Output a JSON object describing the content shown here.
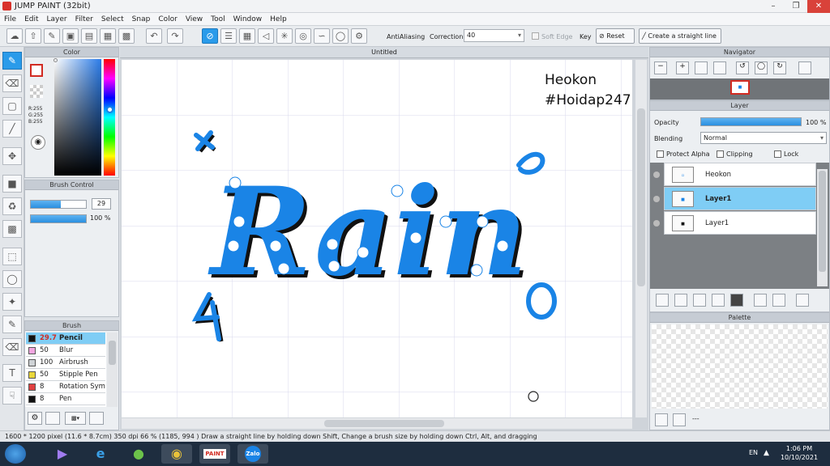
{
  "window": {
    "title": "JUMP PAINT (32bit)"
  },
  "menu": [
    "File",
    "Edit",
    "Layer",
    "Filter",
    "Select",
    "Snap",
    "Color",
    "View",
    "Tool",
    "Window",
    "Help"
  ],
  "toolbar": {
    "antialiasing_label": "AntiAliasing",
    "correction_label": "Correction",
    "correction_value": "40",
    "soft_edge_label": "Soft Edge",
    "key_label": "Key",
    "reset_label": "Reset",
    "straight_line_label": "Create a straight line"
  },
  "color_panel": {
    "title": "Color",
    "r": "R:255",
    "g": "G:255",
    "b": "B:255",
    "primary": "#ffffff",
    "secondary": "#d12b22"
  },
  "brush_control": {
    "title": "Brush Control",
    "size": "29",
    "opacity": "100 %",
    "opacity_fill": 1.0,
    "size_fill": 0.55
  },
  "brush_panel": {
    "title": "Brush",
    "items": [
      {
        "size": "29.7",
        "name": "Pencil",
        "color": "#111111",
        "selected": true
      },
      {
        "size": "50",
        "name": "Blur",
        "color": "#f3a6e0",
        "selected": false
      },
      {
        "size": "100",
        "name": "Airbrush",
        "color": "#cfd3d6",
        "selected": false
      },
      {
        "size": "50",
        "name": "Stipple Pen",
        "color": "#e9d63a",
        "selected": false
      },
      {
        "size": "8",
        "name": "Rotation Symmetry",
        "color": "#e04040",
        "selected": false
      },
      {
        "size": "8",
        "name": "Pen",
        "color": "#111111",
        "selected": false
      }
    ]
  },
  "document": {
    "tab": "Untitled",
    "text_line1": "Heokon",
    "text_line2": "#Hoidap247",
    "art_word": "Rain",
    "art_color": "#1a84e6"
  },
  "navigator": {
    "title": "Navigator"
  },
  "layer_panel": {
    "title": "Layer",
    "opacity_label": "Opacity",
    "opacity_value": "100 %",
    "opacity_fill": 1.0,
    "blending_label": "Blending",
    "blending_value": "Normal",
    "protect_alpha": "Protect Alpha",
    "clipping": "Clipping",
    "lock": "Lock",
    "layers": [
      {
        "name": "Heokon",
        "selected": false
      },
      {
        "name": "Layer1",
        "selected": true
      },
      {
        "name": "Layer1",
        "selected": false
      }
    ]
  },
  "palette_panel": {
    "title": "Palette",
    "footer": "---"
  },
  "status": {
    "text": "1600 * 1200 pixel  (11.6 * 8.7cm)  350 dpi  66 %  (1185, 994 )  Draw a straight line by holding down Shift, Change a brush size by holding down Ctrl, Alt, and dragging"
  },
  "taskbar": {
    "lang": "EN",
    "time": "1:06 PM",
    "date": "10/10/2021",
    "app_zalo": "Zalo",
    "app_jumppaint": "PAINT"
  }
}
